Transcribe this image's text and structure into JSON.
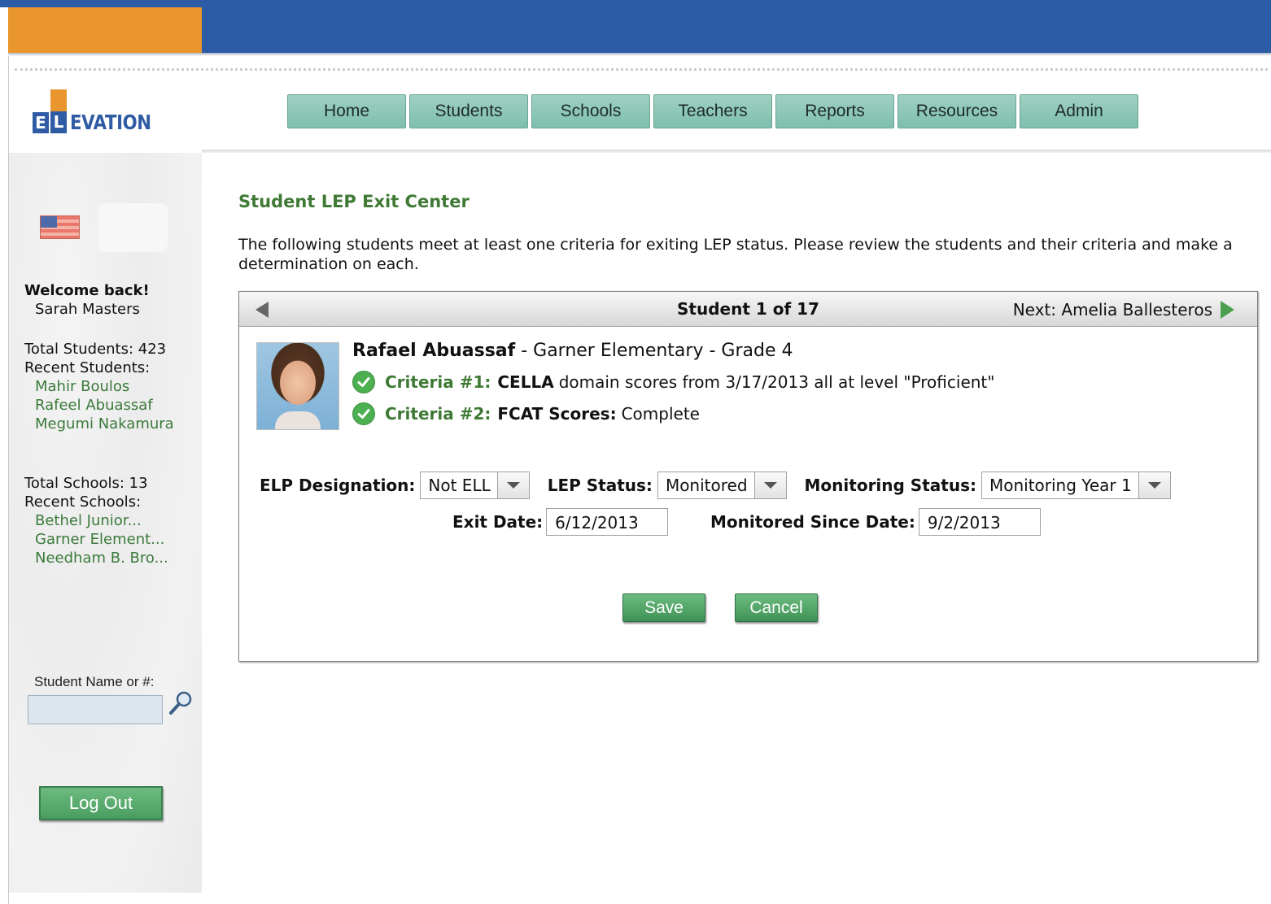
{
  "brand": {
    "logo_block1": "E",
    "logo_block2": "L",
    "logo_text": "EVATION"
  },
  "nav": {
    "tabs": [
      "Home",
      "Students",
      "Schools",
      "Teachers",
      "Reports",
      "Resources",
      "Admin"
    ]
  },
  "sidebar": {
    "welcome": "Welcome back!",
    "user_name": "Sarah Masters",
    "total_students": "Total Students: 423",
    "recent_students_label": "Recent Students:",
    "recent_students": [
      "Mahir Boulos",
      "Rafeel Abuassaf",
      "Megumi Nakamura"
    ],
    "total_schools": "Total Schools: 13",
    "recent_schools_label": "Recent Schools:",
    "recent_schools": [
      "Bethel Junior...",
      "Garner Element...",
      "Needham B. Bro..."
    ],
    "search_label": "Student Name or #:",
    "search_value": "",
    "logout_label": "Log Out"
  },
  "main": {
    "title": "Student LEP Exit Center",
    "intro": "The following students meet at least one criteria for exiting LEP status. Please review the students and their criteria and make a determination on each.",
    "pager": {
      "current": "Student 1 of 17",
      "next": "Next: Amelia Ballesteros"
    },
    "student": {
      "name": "Rafael Abuassaf",
      "details": " - Garner Elementary - Grade 4",
      "criteria": [
        {
          "label": "Criteria #1:",
          "bold": "CELLA",
          "text": "domain scores from 3/17/2013 all at level \"Proficient\""
        },
        {
          "label": "Criteria #2:",
          "bold": "FCAT Scores:",
          "text": "Complete"
        }
      ]
    },
    "form": {
      "elp_label": "ELP Designation:",
      "elp_value": "Not ELL",
      "lep_label": "LEP Status:",
      "lep_value": "Monitored",
      "monitoring_label": "Monitoring Status:",
      "monitoring_value": "Monitoring Year 1",
      "exit_label": "Exit Date:",
      "exit_value": "6/12/2013",
      "monitored_since_label": "Monitored Since Date:",
      "monitored_since_value": "9/2/2013"
    },
    "buttons": {
      "save": "Save",
      "cancel": "Cancel"
    }
  },
  "colors": {
    "brand_blue": "#2c5ca5",
    "brand_orange": "#e8962d",
    "accent_green": "#3f7a35",
    "nav_teal": "#8ec9b8"
  }
}
